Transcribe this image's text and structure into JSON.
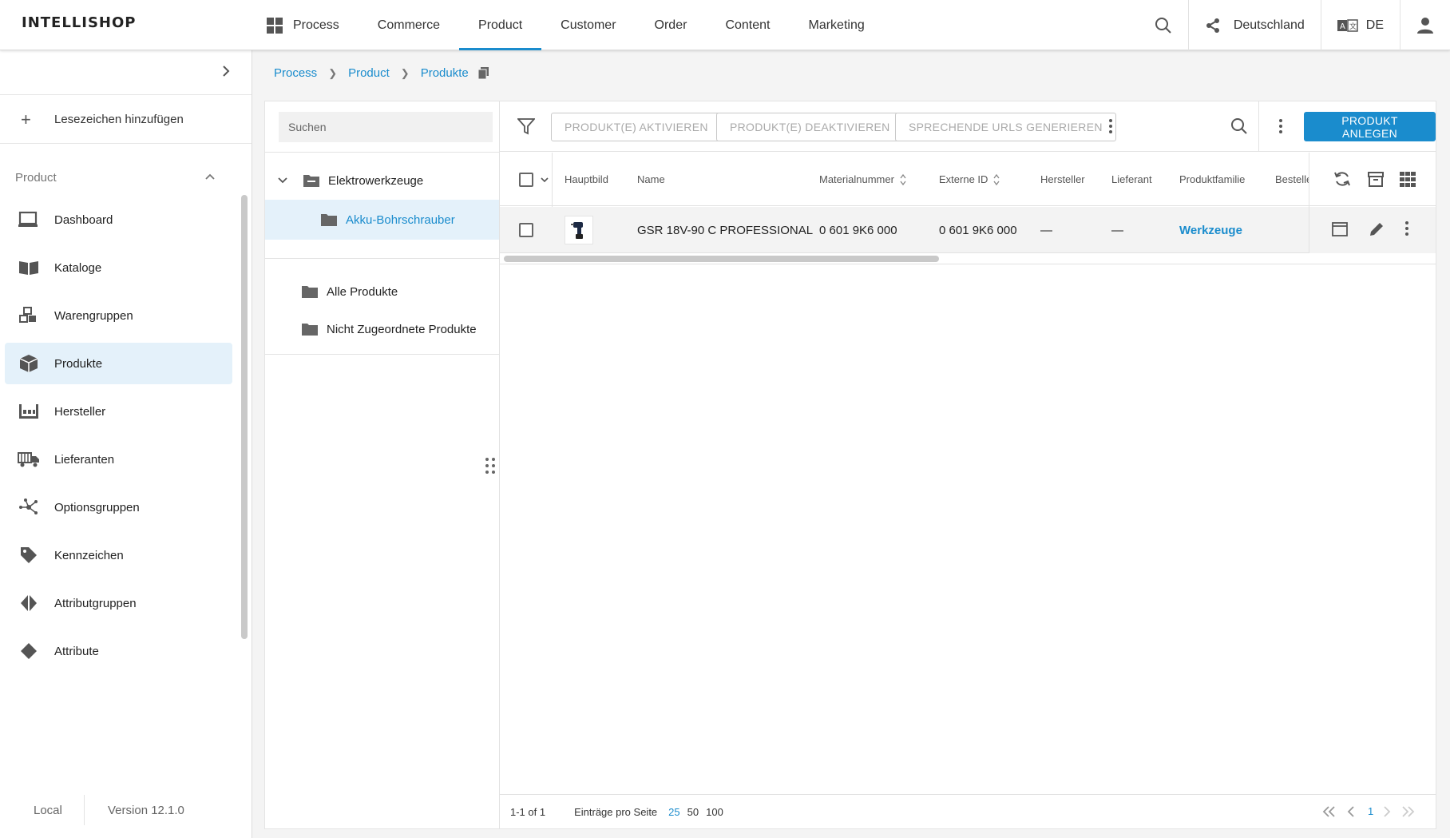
{
  "app": {
    "logo": "INTELLISHOP"
  },
  "topnav": {
    "items": [
      {
        "label": "Process"
      },
      {
        "label": "Commerce"
      },
      {
        "label": "Product"
      },
      {
        "label": "Customer"
      },
      {
        "label": "Order"
      },
      {
        "label": "Content"
      },
      {
        "label": "Marketing"
      }
    ],
    "active": "Product",
    "country": "Deutschland",
    "language": "DE"
  },
  "sidebar": {
    "bookmark_label": "Lesezeichen hinzufügen",
    "section_title": "Product",
    "items": [
      {
        "label": "Dashboard",
        "icon": "monitor-icon"
      },
      {
        "label": "Kataloge",
        "icon": "book-icon"
      },
      {
        "label": "Warengruppen",
        "icon": "cubes-icon"
      },
      {
        "label": "Produkte",
        "icon": "box-icon"
      },
      {
        "label": "Hersteller",
        "icon": "factory-icon"
      },
      {
        "label": "Lieferanten",
        "icon": "truck-icon"
      },
      {
        "label": "Optionsgruppen",
        "icon": "network-icon"
      },
      {
        "label": "Kennzeichen",
        "icon": "tag-icon"
      },
      {
        "label": "Attributgruppen",
        "icon": "diamond-split-icon"
      },
      {
        "label": "Attribute",
        "icon": "diamond-icon"
      }
    ],
    "active": "Produkte",
    "footer": {
      "environment": "Local",
      "version": "Version 12.1.0"
    }
  },
  "breadcrumb": {
    "items": [
      "Process",
      "Product",
      "Produkte"
    ]
  },
  "tree": {
    "search_placeholder": "Suchen",
    "nodes": {
      "root": "Elektrowerkzeuge",
      "child": "Akku-Bohrschrauber",
      "all": "Alle Produkte",
      "unassigned": "Nicht Zugeordnete Produkte"
    }
  },
  "toolbar": {
    "activate": "PRODUKT(E) AKTIVIEREN",
    "deactivate": "PRODUKT(E) DEAKTIVIEREN",
    "generate_urls": "SPRECHENDE URLS GENERIEREN",
    "create": "PRODUKT ANLEGEN"
  },
  "table": {
    "columns": {
      "image": "Hauptbild",
      "name": "Name",
      "material": "Materialnummer",
      "external": "Externe ID",
      "manufacturer": "Hersteller",
      "supplier": "Lieferant",
      "family": "Produktfamilie",
      "order": "Bestelle"
    },
    "rows": [
      {
        "name": "GSR 18V-90 C PROFESSIONAL",
        "material": "0 601 9K6 000",
        "external": "0 601 9K6 000",
        "manufacturer": "—",
        "supplier": "—",
        "family": "Werkzeuge"
      }
    ]
  },
  "pagination": {
    "range": "1-1 of 1",
    "per_page_label": "Einträge pro Seite",
    "sizes": [
      "25",
      "50",
      "100"
    ],
    "selected_size": "25",
    "current_page": "1"
  },
  "colors": {
    "accent": "#1a8ccd",
    "selected_bg": "#e4f1fa"
  }
}
